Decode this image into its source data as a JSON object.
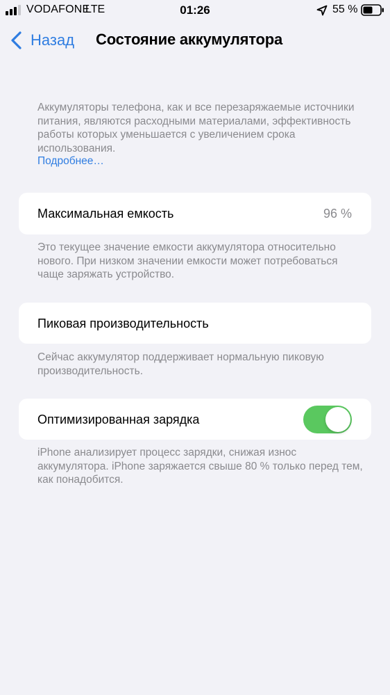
{
  "status_bar": {
    "carrier": "VODAFONE",
    "network": "LTE",
    "time": "01:26",
    "battery_percent": "55 %",
    "icons": [
      "signal-icon",
      "location-icon",
      "battery-icon"
    ]
  },
  "nav": {
    "back_label": "Назад",
    "title": "Состояние аккумулятора"
  },
  "intro": {
    "text": "Аккумуляторы телефона, как и все перезаряжаемые источники питания, являются расходными материалами, эффективность работы которых уменьшается с увеличением срока использования.",
    "link": "Подробнее…"
  },
  "max_capacity": {
    "label": "Максимальная емкость",
    "value": "96 %",
    "footer": "Это текущее значение емкости аккумулятора относительно нового. При низком значении емкости может потребоваться чаще заряжать устройство."
  },
  "peak_performance": {
    "label": "Пиковая производительность",
    "footer": "Сейчас аккумулятор поддерживает нормальную пиковую производительность."
  },
  "optimized_charging": {
    "label": "Оптимизированная зарядка",
    "enabled": true,
    "footer": "iPhone анализирует процесс зарядки, снижая износ аккумулятора. iPhone заряжается свыше 80 % только перед тем, как понадобится."
  },
  "colors": {
    "background": "#f2f2f7",
    "accent": "#2f7de1",
    "toggle_on": "#5ac85f",
    "secondary_text": "#8a8a8e"
  }
}
